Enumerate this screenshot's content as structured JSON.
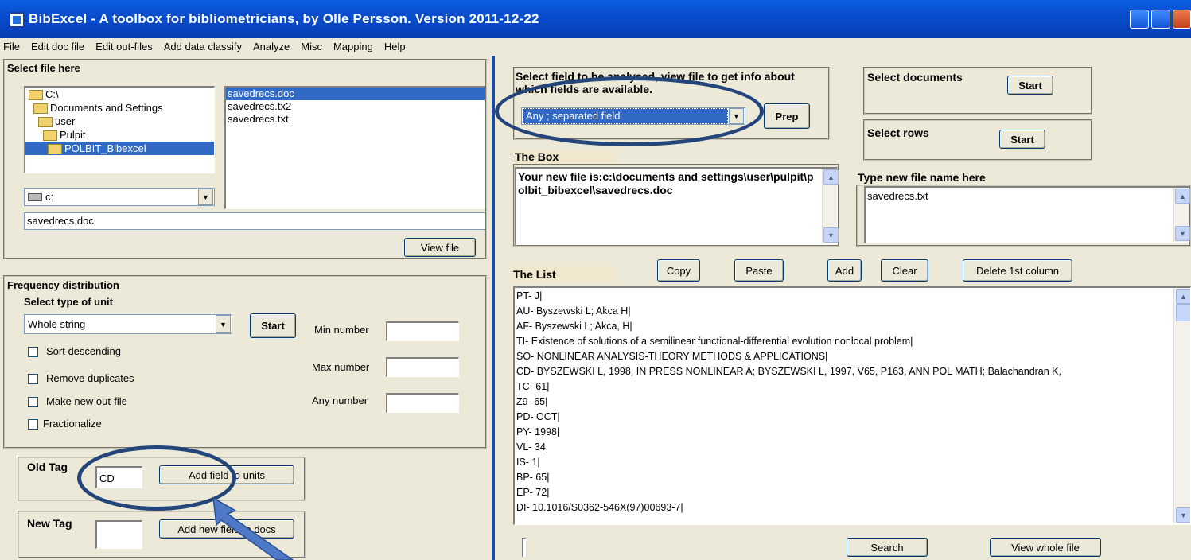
{
  "window": {
    "title": "BibExcel -  A toolbox for bibliometricians, by Olle Persson. Version 2011-12-22"
  },
  "menu": [
    "File",
    "Edit doc file",
    "Edit out-files",
    "Add data classify",
    "Analyze",
    "Misc",
    "Mapping",
    "Help"
  ],
  "select_file": {
    "heading": "Select file here",
    "tree": [
      "C:\\",
      "Documents and Settings",
      "user",
      "Pulpit",
      "POLBIT_Bibexcel"
    ],
    "files": [
      "savedrecs.doc",
      "savedrecs.tx2",
      "savedrecs.txt"
    ],
    "drive": "c:",
    "path_value": "savedrecs.doc",
    "view_file": "View file"
  },
  "frequency": {
    "heading": "Frequency distribution",
    "unit_label": "Select type of unit",
    "unit_value": "Whole string",
    "start": "Start",
    "checks": [
      "Sort descending",
      "Remove duplicates",
      "Make new out-file",
      "Fractionalize"
    ],
    "min_label": "Min number",
    "max_label": "Max number",
    "any_label": "Any number"
  },
  "old_tag": {
    "label": "Old Tag",
    "value": "CD",
    "button": "Add field to units"
  },
  "new_tag": {
    "label": "New Tag",
    "value": "",
    "button": "Add new field to docs"
  },
  "select_field": {
    "text": "Select field to be analysed, view file to get info about which fields are available.",
    "value": "Any ; separated field",
    "prep": "Prep"
  },
  "select_documents": {
    "label": "Select documents",
    "start": "Start"
  },
  "select_rows": {
    "label": "Select rows",
    "start": "Start"
  },
  "the_box": {
    "label": "The Box",
    "text": "Your new file is:c:\\documents and settings\\user\\pulpit\\polbit_bibexcel\\savedrecs.doc"
  },
  "new_file": {
    "label": "Type new file name here",
    "value": "savedrecs.txt"
  },
  "the_list": {
    "label": "The List",
    "buttons": [
      "Copy",
      "Paste",
      "Add",
      "Clear",
      "Delete 1st column"
    ],
    "rows": [
      "PT- J|",
      "AU- Byszewski L; Akca H|",
      "AF- Byszewski L; Akca, H|",
      "TI- Existence of solutions of a semilinear functional-differential evolution nonlocal problem|",
      "SO- NONLINEAR ANALYSIS-THEORY METHODS & APPLICATIONS|",
      "CD- BYSZEWSKI L, 1998, IN PRESS NONLINEAR A; BYSZEWSKI L, 1997, V65, P163, ANN POL MATH; Balachandran K,",
      "TC- 61|",
      "Z9- 65|",
      "PD- OCT|",
      "PY- 1998|",
      "VL- 34|",
      "IS- 1|",
      "BP- 65|",
      "EP- 72|",
      "DI- 10.1016/S0362-546X(97)00693-7|"
    ],
    "search": "Search",
    "view_whole": "View whole file"
  }
}
